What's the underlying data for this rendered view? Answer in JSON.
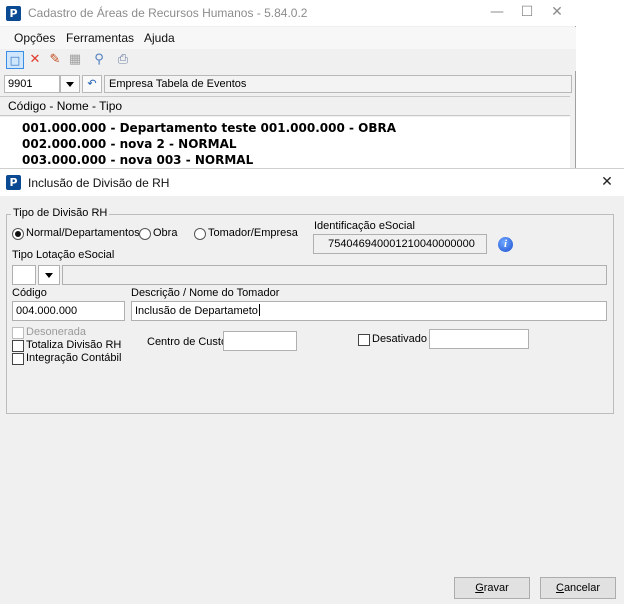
{
  "back_window": {
    "title": "Cadastro de Áreas de Recursos Humanos - 5.84.0.2",
    "window_buttons": {
      "minimize": "—",
      "maximize": "☐",
      "close": "✕"
    },
    "menu": [
      "Opções",
      "Ferramentas",
      "Ajuda"
    ],
    "toolbar_icons": [
      "new-icon",
      "delete-icon",
      "edit-icon",
      "calculator-icon",
      "search-icon",
      "print-icon"
    ],
    "company": {
      "code": "9901",
      "name": "Empresa Tabela de Eventos"
    },
    "list_header": "Código - Nome - Tipo",
    "list_items": [
      "001.000.000 - Departamento teste 001.000.000 - OBRA",
      "002.000.000 - nova 2 - NORMAL",
      "003.000.000 - nova 003 - NORMAL"
    ]
  },
  "dialog": {
    "title": "Inclusão de Divisão de RH",
    "close_glyph": "✕",
    "group_label": "Tipo de Divisão RH",
    "radio_options": [
      {
        "label": "Normal/Departamentos",
        "checked": true
      },
      {
        "label": "Obra",
        "checked": false
      },
      {
        "label": "Tomador/Empresa",
        "checked": false
      }
    ],
    "esocial_id": {
      "label": "Identificação eSocial",
      "value": "754046940001210040000000"
    },
    "tipo_lotacao": {
      "label": "Tipo Lotação eSocial",
      "value": "",
      "description": ""
    },
    "codigo": {
      "label": "Código",
      "value": "004.000.000"
    },
    "descricao": {
      "label": "Descrição / Nome do Tomador",
      "value": "Inclusão de Departameto"
    },
    "desonerada": {
      "label": "Desonerada",
      "checked": false,
      "disabled": true
    },
    "totaliza": {
      "label": "Totaliza Divisão RH",
      "checked": false
    },
    "integracao": {
      "label": "Integração Contábil",
      "checked": false
    },
    "centro_custo": {
      "label": "Centro de Custo",
      "value": ""
    },
    "desativado": {
      "label": "Desativado",
      "checked": false,
      "value": ""
    },
    "buttons": {
      "save": {
        "accel": "G",
        "rest": "ravar"
      },
      "cancel": {
        "accel": "C",
        "rest": "ancelar"
      }
    }
  }
}
